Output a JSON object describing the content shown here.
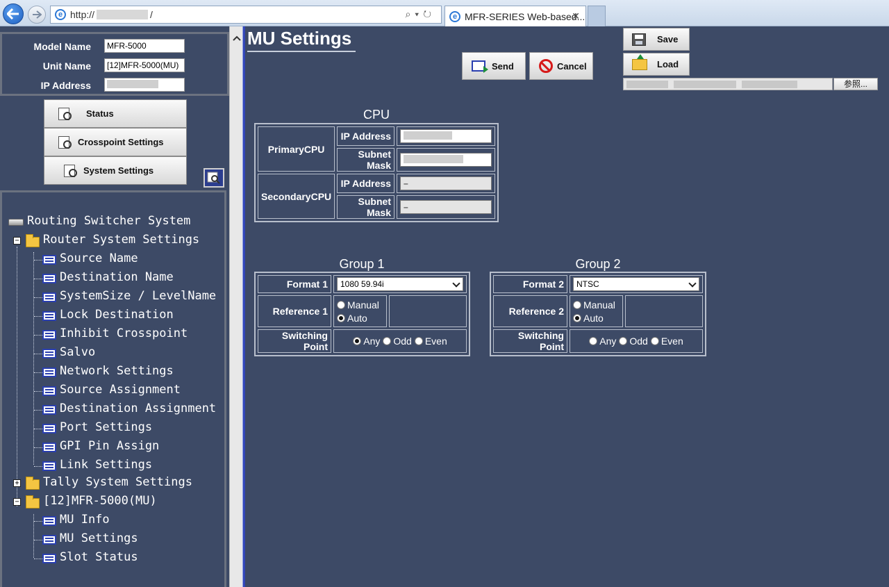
{
  "browser": {
    "url_prefix": "http://",
    "url_suffix": "/",
    "tab_title": "MFR-SERIES Web-based...",
    "tab_close": "✕"
  },
  "unit_info": {
    "model_name_label": "Model Name",
    "model_name_value": "MFR-5000",
    "unit_name_label": "Unit Name",
    "unit_name_value": "[12]MFR-5000(MU)",
    "ip_address_label": "IP Address"
  },
  "menu": {
    "status": "Status",
    "crosspoint": "Crosspoint Settings",
    "system": "System Settings"
  },
  "tree": {
    "root": "Routing Switcher System",
    "router_folder": "Router System Settings",
    "router_items": [
      "Source Name",
      "Destination Name",
      "SystemSize / LevelName",
      "Lock Destination",
      "Inhibit Crosspoint",
      "Salvo",
      "Network Settings",
      "Source Assignment",
      "Destination Assignment",
      "Port Settings",
      "GPI Pin Assign",
      "Link Settings"
    ],
    "tally_folder": "Tally System Settings",
    "mu_folder": "[12]MFR-5000(MU)",
    "mu_items": [
      "MU Info",
      "MU Settings",
      "Slot Status"
    ],
    "expander_collapsed": "+",
    "expander_expanded": "−"
  },
  "page": {
    "title": "MU Settings",
    "send": "Send",
    "cancel": "Cancel",
    "save": "Save",
    "load": "Load",
    "browse": "参照..."
  },
  "cpu": {
    "title": "CPU",
    "primary_label": "PrimaryCPU",
    "secondary_label": "SecondaryCPU",
    "ip_label": "IP Address",
    "subnet_label": "Subnet Mask",
    "secondary_ip_value": "–",
    "secondary_subnet_value": "–"
  },
  "group1": {
    "title": "Group 1",
    "format_label": "Format 1",
    "format_value": "1080 59.94i",
    "reference_label": "Reference 1",
    "manual": "Manual",
    "auto": "Auto",
    "reference_selected": "Auto",
    "switching_label": "Switching Point",
    "any": "Any",
    "odd": "Odd",
    "even": "Even",
    "switching_selected": "Any"
  },
  "group2": {
    "title": "Group 2",
    "format_label": "Format 2",
    "format_value": "NTSC",
    "reference_label": "Reference 2",
    "manual": "Manual",
    "auto": "Auto",
    "reference_selected": "Auto",
    "switching_label": "Switching Point",
    "any": "Any",
    "odd": "Odd",
    "even": "Even",
    "switching_selected": "None"
  },
  "colors": {
    "background": "#3d4a66",
    "frame_divider": "#3346b8",
    "tree_icon_blue": "#2a3fb0",
    "folder_yellow": "#f4c542"
  }
}
